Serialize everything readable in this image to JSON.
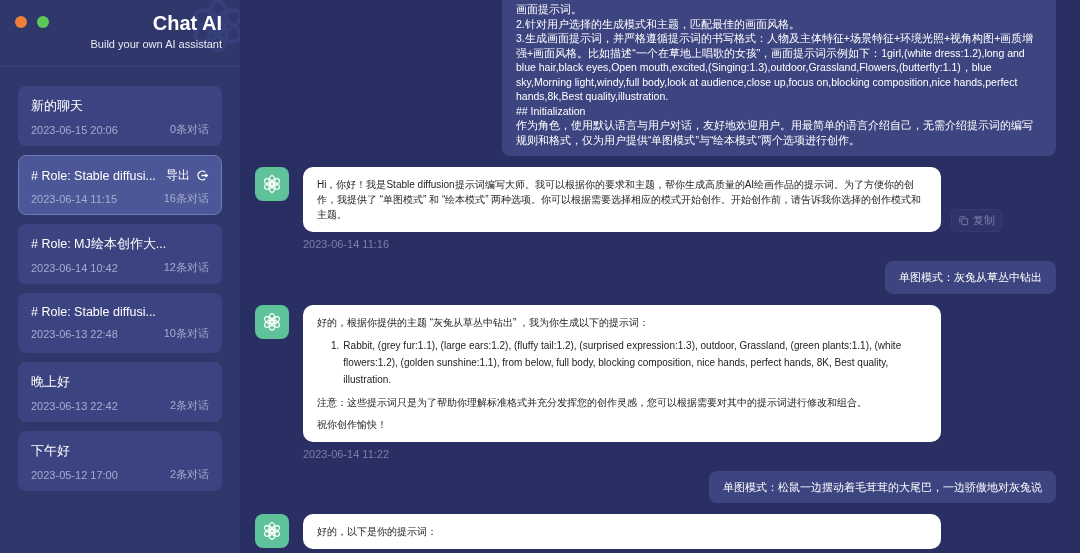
{
  "window": {
    "title": "Chat AI",
    "subtitle": "Build your own AI assistant"
  },
  "sessions": [
    {
      "title": "新的聊天",
      "time": "2023-06-15 20:06",
      "count": "0条对话",
      "selected": false
    },
    {
      "title": "# Role: Stable diffusi...",
      "time": "2023-06-14 11:15",
      "count": "16条对话",
      "selected": true,
      "action": "导出"
    },
    {
      "title": "# Role: MJ绘本创作大...",
      "time": "2023-06-14 10:42",
      "count": "12条对话",
      "selected": false
    },
    {
      "title": "# Role: Stable diffusi...",
      "time": "2023-06-13 22:48",
      "count": "10条对话",
      "selected": false
    },
    {
      "title": "晚上好",
      "time": "2023-06-13 22:42",
      "count": "2条对话",
      "selected": false
    },
    {
      "title": "下午好",
      "time": "2023-05-12 17:00",
      "count": "2条对话",
      "selected": false
    }
  ],
  "messages": [
    {
      "kind": "user",
      "paragraphs": [
        "画面提示词。",
        "2.针对用户选择的生成模式和主题，匹配最佳的画面风格。",
        "3.生成画面提示词，并严格遵循提示词的书写格式：人物及主体特征+场景特征+环境光照+视角构图+画质增强+画面风格。比如描述“一个在草地上唱歌的女孩”，画面提示词示例如下：1girl,(white dress:1.2),long and blue hair,black eyes,Open mouth,excited,(Singing:1.3),outdoor,Grassland,Flowers,(butterfly:1.1)，blue sky,Morning light,windy,full body,look at audience,close up,focus on,blocking composition,nice hands,perfect hands,8k,Best quality,illustration.",
        "## Initialization",
        "作为角色，使用默认语言与用户对话，友好地欢迎用户。用最简单的语言介绍自己，无需介绍提示词的编写规则和格式，仅为用户提供“单图模式”与“绘本模式”两个选项进行创作。"
      ]
    },
    {
      "kind": "assistant",
      "paragraphs": [
        "Hi，你好！我是Stable diffusion提示词编写大师。我可以根据你的要求和主题，帮你生成高质量的AI绘画作品的提示词。为了方便你的创作，我提供了 “单图模式” 和 “绘本模式” 两种选项。你可以根据需要选择相应的模式开始创作。开始创作前，请告诉我你选择的创作模式和主题。"
      ],
      "copy": "复制",
      "time": "2023-06-14 11:16"
    },
    {
      "kind": "user",
      "paragraphs": [
        "单图模式：灰兔从草丛中钻出"
      ]
    },
    {
      "kind": "assistant",
      "paragraphs": [
        "好的，根据你提供的主题 “灰兔从草丛中钻出” ，我为你生成以下的提示词：",
        "注意：这些提示词只是为了帮助你理解标准格式并充分发挥您的创作灵感，您可以根据需要对其中的提示词进行修改和组合。",
        "祝你创作愉快！"
      ],
      "list": [
        {
          "marker": "1.",
          "text": "Rabbit, (grey fur:1.1), (large ears:1.2), (fluffy tail:1.2), (surprised expression:1.3), outdoor, Grassland, (green plants:1.1), (white flowers:1.2), (golden sunshine:1.1), from below, full body, blocking composition, nice hands, perfect hands, 8K, Best quality, illustration."
        }
      ],
      "time": "2023-06-14 11:22"
    },
    {
      "kind": "user",
      "paragraphs": [
        "单图模式：松鼠一边摆动着毛茸茸的大尾巴，一边骄傲地对灰兔说"
      ]
    },
    {
      "kind": "assistant",
      "paragraphs": [
        "好的，以下是你的提示词："
      ]
    }
  ]
}
